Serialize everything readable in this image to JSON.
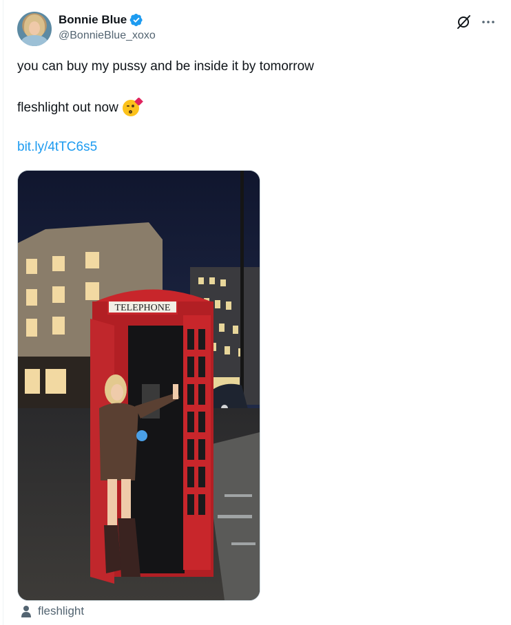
{
  "author": {
    "display_name": "Bonnie Blue",
    "handle": "@BonnieBlue_xoxo",
    "verified": true,
    "verified_color": "#1d9bf0"
  },
  "tweet": {
    "line1": "you can buy my pussy and be inside it by tomorrow",
    "line2": "fleshlight out now",
    "emoji": "face-blowing-a-kiss",
    "link": "bit.ly/4tTC6s5"
  },
  "media": {
    "sign_text": "TELEPHONE"
  },
  "footer": {
    "label": "fleshlight",
    "icon": "person-icon"
  },
  "colors": {
    "text": "#0f1419",
    "secondary": "#536471",
    "link": "#1d9bf0",
    "booth_red": "#c8262b"
  }
}
